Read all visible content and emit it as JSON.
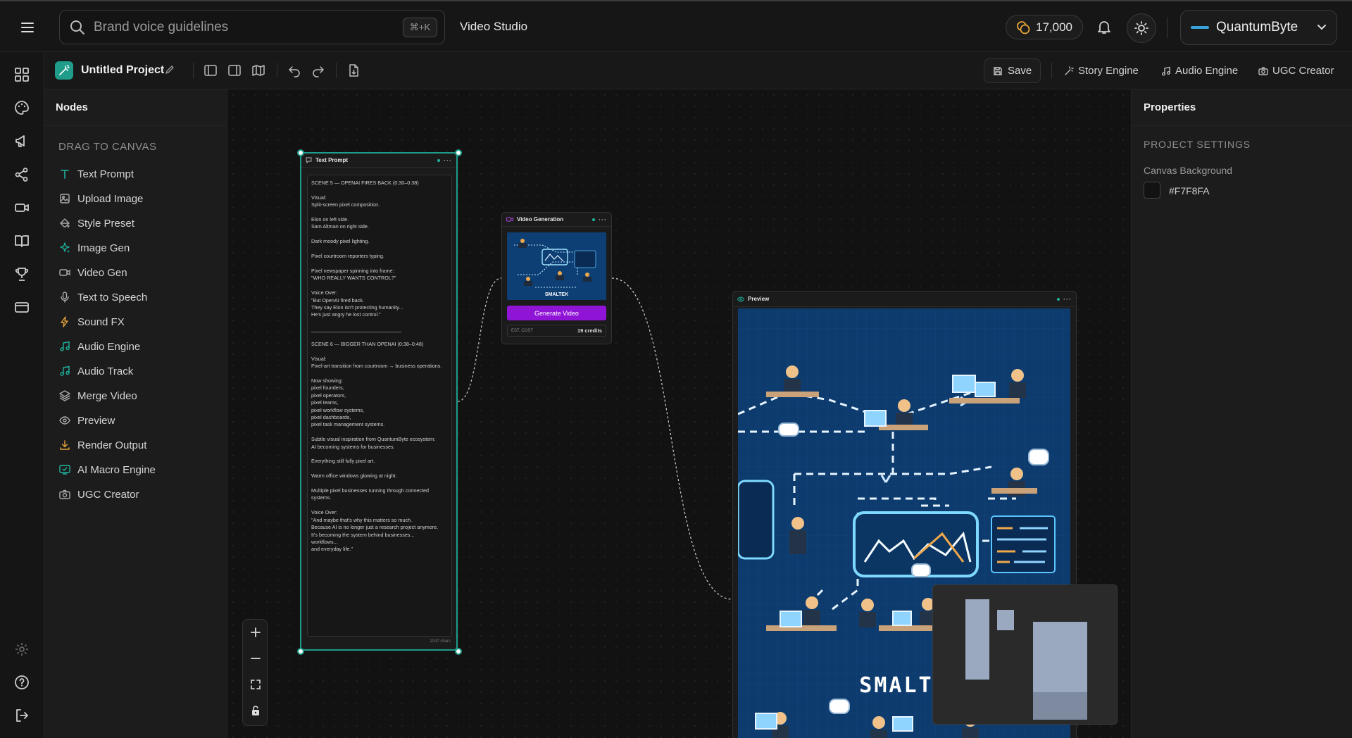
{
  "header": {
    "search_placeholder": "Brand voice guidelines",
    "shortcut": "⌘+K",
    "studio_title": "Video Studio",
    "credits": "17,000",
    "account_name": "QuantumByte"
  },
  "project": {
    "name": "Untitled Project",
    "save_label": "Save",
    "links": [
      "Story Engine",
      "Audio Engine",
      "UGC Creator"
    ]
  },
  "nodes_panel": {
    "title": "Nodes",
    "section_label": "DRAG TO CANVAS",
    "items": [
      {
        "label": "Text Prompt",
        "icon": "text-icon"
      },
      {
        "label": "Upload Image",
        "icon": "image-icon"
      },
      {
        "label": "Style Preset",
        "icon": "paint-bucket-icon"
      },
      {
        "label": "Image Gen",
        "icon": "sparkle-icon"
      },
      {
        "label": "Video Gen",
        "icon": "video-icon"
      },
      {
        "label": "Text to Speech",
        "icon": "mic-icon"
      },
      {
        "label": "Sound FX",
        "icon": "bolt-icon"
      },
      {
        "label": "Audio Engine",
        "icon": "music-icon"
      },
      {
        "label": "Audio Track",
        "icon": "music-icon"
      },
      {
        "label": "Merge Video",
        "icon": "layers-icon"
      },
      {
        "label": "Preview",
        "icon": "eye-icon"
      },
      {
        "label": "Render Output",
        "icon": "download-icon"
      },
      {
        "label": "AI Macro Engine",
        "icon": "screen-icon"
      },
      {
        "label": "UGC Creator",
        "icon": "camera-icon"
      }
    ]
  },
  "canvas": {
    "text_node": {
      "title": "Text Prompt",
      "char_count": "1047 chars",
      "content": "SCENE 5 — OPENAI FIRES BACK (0:30–0:38)\n\nVisual:\nSplit-screen pixel composition.\n\nElon on left side.\nSam Altman on right side.\n\nDark moody pixel lighting.\n\nPixel courtroom reporters typing.\n\nPixel newspaper spinning into frame:\n\"WHO REALLY WANTS CONTROL?\"\n\nVoice Over:\n\"But OpenAI fired back.\nThey say Elon isn't protecting humanity...\nHe's just angry he lost control.\"\n\n________________________________\n\nSCENE 6 — BIGGER THAN OPENAI (0:38–0:48)\n\nVisual:\nPixel-art transition from courtroom → business operations.\n\nNow showing:\npixel founders,\npixel operators,\npixel teams,\npixel workflow systems,\npixel dashboards,\npixel task management systems.\n\nSubtle visual inspiration from QuantumByte ecosystem:\nAI becoming systems for businesses.\n\nEverything still fully pixel art.\n\nWarm office windows glowing at night.\n\nMultiple pixel businesses running through connected systems.\n\nVoice Over:\n\"And maybe that's why this matters so much.\nBecause AI is no longer just a research project anymore.\nIt's becoming the system behind businesses...\nworkflows...\nand everyday life.\""
    },
    "video_node": {
      "title": "Video Generation",
      "button_label": "Generate Video",
      "cost_label": "EST. COST",
      "cost_value": "19 credits",
      "thumb_text": "SMALTEK"
    },
    "preview_node": {
      "title": "Preview",
      "image_text": "SMALTEK"
    }
  },
  "properties": {
    "title": "Properties",
    "section": "PROJECT SETTINGS",
    "canvas_bg_label": "Canvas Background",
    "canvas_bg_value": "#F7F8FA"
  },
  "colors": {
    "accent_teal": "#1f9c8a",
    "generate_purple": "#8f14d6"
  }
}
